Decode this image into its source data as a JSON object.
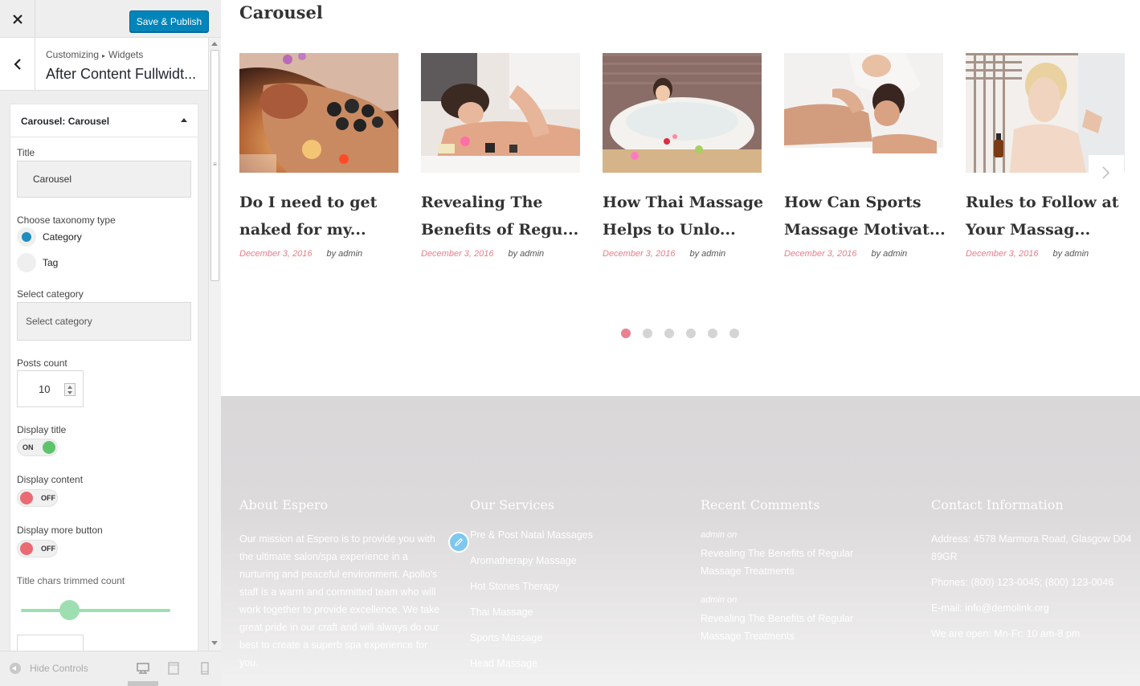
{
  "customizer": {
    "save_publish": "Save & Publish",
    "breadcrumb": {
      "root": "Customizing",
      "section": "Widgets",
      "title": "After Content Fullwidt..."
    },
    "widget": {
      "header_prefix": "Carousel:",
      "header_name": "Carousel",
      "title_label": "Title",
      "title_value": "Carousel",
      "taxonomy_label": "Choose taxonomy type",
      "taxonomy_options": [
        "Category",
        "Tag"
      ],
      "taxonomy_selected": "Category",
      "select_category_label": "Select category",
      "select_category_value": "Select category",
      "posts_count_label": "Posts count",
      "posts_count_value": "10",
      "display_title_label": "Display title",
      "display_title_state": "ON",
      "display_content_label": "Display content",
      "display_content_state": "OFF",
      "display_more_label": "Display more button",
      "display_more_state": "OFF",
      "title_chars_label": "Title chars trimmed count",
      "title_chars_slider_fraction": 0.32
    },
    "hide_controls": "Hide Controls",
    "devices": [
      "desktop-icon",
      "tablet-icon",
      "mobile-icon"
    ]
  },
  "preview": {
    "section_title": "Carousel",
    "posts": [
      {
        "title_line1": "Do I need to get",
        "title_line2": "naked for my...",
        "date": "December 3, 2016",
        "author": "by admin"
      },
      {
        "title_line1": "Revealing The",
        "title_line2": "Benefits of Regu...",
        "date": "December 3, 2016",
        "author": "by admin"
      },
      {
        "title_line1": "How Thai Massage",
        "title_line2": "Helps to Unlo...",
        "date": "December 3, 2016",
        "author": "by admin"
      },
      {
        "title_line1": "How Can Sports",
        "title_line2": "Massage Motivat...",
        "date": "December 3, 2016",
        "author": "by admin"
      },
      {
        "title_line1": "Rules to Follow at",
        "title_line2": "Your Massag...",
        "date": "December 3, 2016",
        "author": "by admin"
      }
    ],
    "dots_count": 6,
    "active_dot": 1,
    "footer": {
      "about": {
        "heading": "About Espero",
        "text": "Our mission at Espero is to provide you with the ultimate salon/spa experience in a nurturing and peaceful environment. Apollo's staff is a warm and committed team who will work together to provide excellence. We take great pride in our craft and will always do our best to create a superb spa experience for you."
      },
      "services": {
        "heading": "Our Services",
        "items": [
          "Pre & Post Natal Massages",
          "Aromatherapy Massage",
          "Hot Stones Therapy",
          "Thai Massage",
          "Sports Massage",
          "Head Massage"
        ]
      },
      "comments": {
        "heading": "Recent Comments",
        "items": [
          {
            "meta": "admin  on",
            "link": "Revealing The Benefits of Regular Massage Treatments"
          },
          {
            "meta": "admin  on",
            "link": "Revealing The Benefits of Regular Massage Treatments"
          }
        ]
      },
      "contact": {
        "heading": "Contact Information",
        "address": "Address: 4578 Marmora Road, Glasgow D04 89GR",
        "phones": "Phones: (800) 123-0045; (800) 123-0046",
        "email_label": "E-mail:",
        "email": "info@demolink.org",
        "hours": "We are open: Mn-Fr: 10 am-8 pm"
      }
    }
  },
  "colors": {
    "accent_blue": "#0085ba",
    "date_pink": "#e87d8a",
    "toggle_on": "#5ec46b",
    "toggle_off": "#ea6b73",
    "dot_active": "#ea8090"
  }
}
